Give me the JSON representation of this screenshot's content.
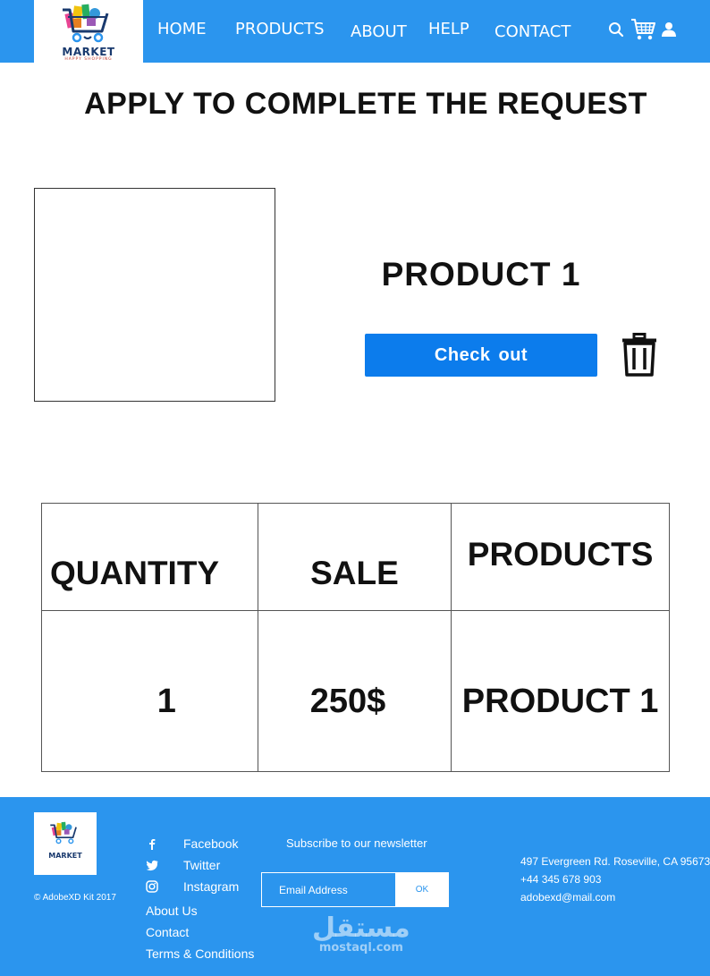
{
  "header": {
    "logo_text": "MARKET",
    "logo_subtext": "HAPPY SHOPPING",
    "nav": {
      "home": "HOME",
      "products": "PRODUCTS",
      "about": "ABOUT",
      "help": "HELP",
      "contact": "CONTACT"
    },
    "icons": [
      "search-icon",
      "cart-icon",
      "user-icon"
    ],
    "background_color": "#2b95ee"
  },
  "page_title": "APPLY TO COMPLETE THE REQUEST",
  "product": {
    "name": "PRODUCT 1",
    "checkout_label": "Check  out",
    "checkout_color": "#0c7cec",
    "delete_icon": "trash-icon"
  },
  "order_table": {
    "headers": {
      "quantity": "QUANTITY",
      "sale": "SALE",
      "products": "PRODUCTS"
    },
    "row": {
      "quantity": "1",
      "sale": "250$",
      "product": "PRODUCT 1"
    }
  },
  "footer": {
    "logo_text": "MARKET",
    "copyright": "© AdobeXD Kit 2017",
    "social": {
      "facebook": "Facebook",
      "twitter": "Twitter",
      "instagram": "Instagram"
    },
    "links": {
      "about": "About Us",
      "contact": "Contact",
      "terms": "Terms & Conditions"
    },
    "newsletter": {
      "title": "Subscribe to our newsletter",
      "email_placeholder": "Email Address",
      "ok_label": "OK"
    },
    "address": {
      "street": "497 Evergreen Rd. Roseville, CA 95673",
      "phone": "+44 345 678 903",
      "email": "adobexd@mail.com"
    },
    "watermark": {
      "arabic": "مستقل",
      "latin": "mostaql.com"
    }
  }
}
